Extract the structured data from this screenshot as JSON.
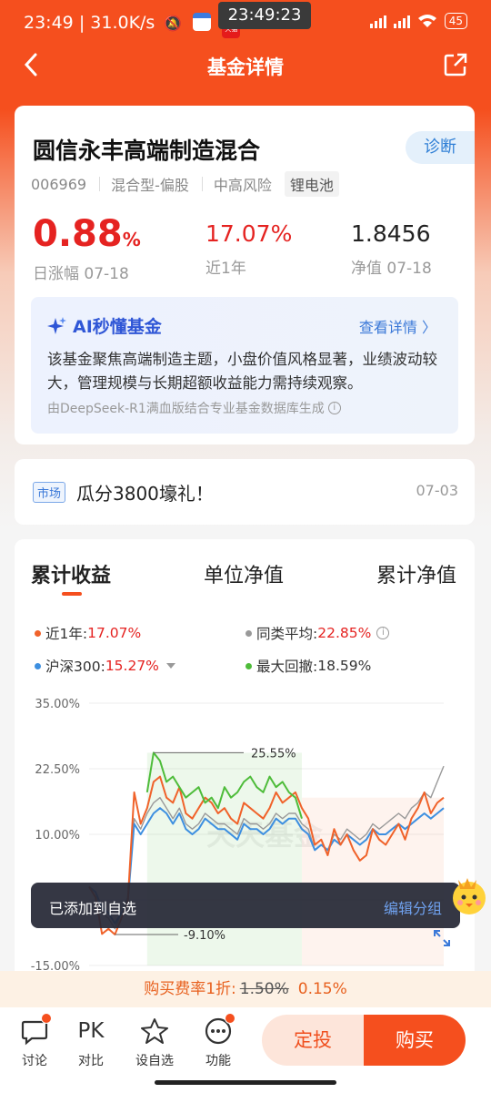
{
  "status_bar": {
    "time": "23:49",
    "speed": "31.0K/s",
    "clock_overlay": "23:49:23",
    "tmall_label": "天猫",
    "battery": "45",
    "network": "HD"
  },
  "navbar": {
    "title": "基金详情"
  },
  "fund": {
    "name": "圆信永丰高端制造混合",
    "diagnose_label": "诊断",
    "code": "006969",
    "type": "混合型-偏股",
    "risk": "中高风险",
    "theme_tag": "锂电池",
    "daily_change": "0.88",
    "daily_change_unit": "%",
    "daily_change_label": "日涨幅 07-18",
    "year_return": "17.07%",
    "year_return_label": "近1年",
    "nav": "1.8456",
    "nav_label": "净值 07-18"
  },
  "ai": {
    "title": "AI秒懂基金",
    "more": "查看详情 〉",
    "text": "该基金聚焦高端制造主题，小盘价值风格显著，业绩波动较大，管理规模与长期超额收益能力需持续观察。",
    "footer": "由DeepSeek-R1满血版结合专业基金数据库生成"
  },
  "news": {
    "tag": "市场",
    "text": "瓜分3800壕礼！",
    "date": "07-03"
  },
  "chart_tabs": [
    "累计收益",
    "单位净值",
    "累计净值"
  ],
  "legend": {
    "fund_label": "近1年:",
    "fund_value": "17.07%",
    "avg_label": "同类平均:",
    "avg_value": "22.85%",
    "index_label": "沪深300:",
    "index_value": "15.27%",
    "drawdown_label": "最大回撤:",
    "drawdown_value": "18.59%"
  },
  "chart_data": {
    "type": "line",
    "ylim": [
      -15,
      35
    ],
    "yticks": [
      "35.00%",
      "22.50%",
      "10.00%",
      "-15.00%"
    ],
    "annotations": {
      "max": "25.55%",
      "min": "-9.10%"
    },
    "watermark": "天天基金",
    "series": [
      {
        "name": "近1年",
        "color": "#f0622a",
        "values": [
          0,
          -2,
          -9,
          -8,
          -9.1,
          -6,
          -3,
          18,
          12,
          15,
          20,
          21,
          17,
          16,
          19,
          14,
          13,
          15,
          17,
          16,
          14,
          15,
          13,
          12,
          16,
          15,
          14,
          13,
          15,
          18,
          16,
          17,
          18,
          15,
          13,
          8,
          9,
          6,
          11,
          8,
          10,
          7,
          5,
          6,
          11,
          9,
          8,
          10,
          12,
          9,
          13,
          15,
          18,
          14,
          16,
          17
        ]
      },
      {
        "name": "同类平均",
        "color": "#999999",
        "values": [
          0,
          -1,
          -5,
          -6,
          -8,
          -5,
          -2,
          13,
          11,
          14,
          16,
          17,
          15,
          13,
          15,
          12,
          11,
          12,
          14,
          13,
          12,
          12,
          11,
          10,
          13,
          12,
          12,
          11,
          12,
          14,
          13,
          14,
          14,
          12,
          11,
          7,
          8,
          7,
          10,
          9,
          11,
          10,
          9,
          10,
          12,
          11,
          12,
          13,
          14,
          13,
          15,
          16,
          18,
          17,
          20,
          23
        ]
      },
      {
        "name": "沪深300",
        "color": "#3d8fe0",
        "values": [
          0,
          -1,
          -4,
          -5,
          -7,
          -5,
          -3,
          12,
          10,
          12,
          14,
          15,
          14,
          12,
          14,
          11,
          10,
          11,
          13,
          12,
          11,
          11,
          10,
          9,
          12,
          11,
          11,
          10,
          11,
          13,
          12,
          13,
          13,
          11,
          10,
          7,
          8,
          7,
          9,
          8,
          10,
          9,
          8,
          9,
          11,
          10,
          10,
          11,
          12,
          11,
          12,
          13,
          14,
          13,
          14,
          15
        ]
      },
      {
        "name": "最大回撤",
        "color": "#4ebc3a",
        "values": [
          null,
          null,
          null,
          null,
          null,
          null,
          null,
          null,
          null,
          18,
          25.55,
          24,
          20,
          21,
          19,
          17,
          18,
          19,
          16,
          17,
          15,
          19,
          17,
          18,
          20,
          21,
          19,
          18,
          21,
          19,
          20,
          18,
          17,
          13,
          null,
          null,
          null,
          null,
          null,
          null,
          null,
          null,
          null,
          null,
          null,
          null,
          null,
          null,
          null,
          null,
          null,
          null,
          null,
          null,
          null,
          null
        ]
      }
    ]
  },
  "toast": {
    "message": "已添加到自选",
    "action": "编辑分组"
  },
  "fee": {
    "label": "购买费率1折:",
    "original": "1.50%",
    "current": "0.15%"
  },
  "bottom_nav": [
    {
      "label": "讨论"
    },
    {
      "label": "对比",
      "glyph": "PK"
    },
    {
      "label": "设自选"
    },
    {
      "label": "功能"
    }
  ],
  "actions": {
    "fixed_invest": "定投",
    "buy": "购买"
  }
}
